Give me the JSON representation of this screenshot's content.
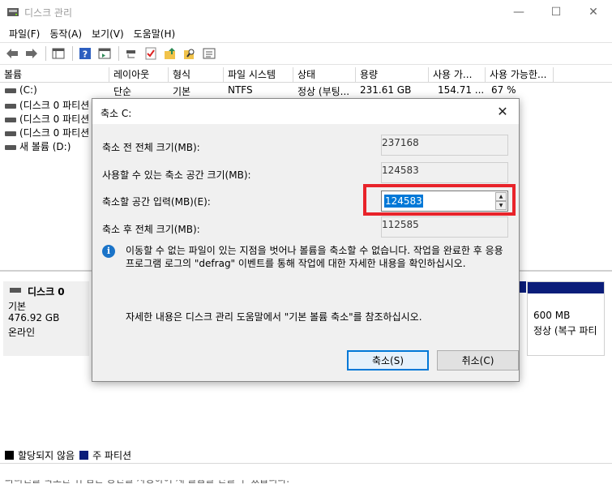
{
  "window": {
    "title": "디스크 관리",
    "minimize": "—",
    "maximize": "☐",
    "close": "✕"
  },
  "menu": [
    "파일(F)",
    "동작(A)",
    "보기(V)",
    "도움말(H)"
  ],
  "volume_table": {
    "headers": [
      "볼륨",
      "레이아웃",
      "형식",
      "파일 시스템",
      "상태",
      "용량",
      "사용 가...",
      "사용 가능한..."
    ],
    "rows": [
      {
        "volume": "(C:)",
        "layout": "단순",
        "type": "기본",
        "fs": "NTFS",
        "status": "정상 (부팅...",
        "capacity": "231.61 GB",
        "free": "154.71 ...",
        "pct": "67 %"
      },
      {
        "volume": "(디스크 0 파티션",
        "layout": "",
        "type": "",
        "fs": "",
        "status": "",
        "capacity": "",
        "free": "",
        "pct": ""
      },
      {
        "volume": "(디스크 0 파티션",
        "layout": "",
        "type": "",
        "fs": "",
        "status": "",
        "capacity": "",
        "free": "",
        "pct": ""
      },
      {
        "volume": "(디스크 0 파티션",
        "layout": "",
        "type": "",
        "fs": "",
        "status": "",
        "capacity": "",
        "free": "",
        "pct": ""
      },
      {
        "volume": "새 볼륨 (D:)",
        "layout": "",
        "type": "",
        "fs": "",
        "status": "",
        "capacity": "",
        "free": "",
        "pct": ""
      }
    ]
  },
  "disk": {
    "name": "디스크 0",
    "type": "기본",
    "size": "476.92 GB",
    "status": "온라인",
    "last_partition": {
      "size": "600 MB",
      "status": "정상 (복구 파티"
    }
  },
  "legend": [
    {
      "label": "할당되지 않음",
      "color": "#000000"
    },
    {
      "label": "주 파티션",
      "color": "#0b1d7a"
    }
  ],
  "bottom_partial_text": "파티션을 축소한 뒤 남은 공간을 사용하여 새 볼륨을 만들 수 있습니다.",
  "dialog": {
    "title": "축소 C:",
    "close": "✕",
    "total_before_label": "축소 전 전체 크기(MB):",
    "total_before_value": "237168",
    "available_label": "사용할 수 있는 축소 공간 크기(MB):",
    "available_value": "124583",
    "input_label": "축소할 공간 입력(MB)(E):",
    "input_value": "124583",
    "total_after_label": "축소 후 전체 크기(MB):",
    "total_after_value": "112585",
    "info_text": "이동할 수 없는 파일이 있는 지점을 벗어나 볼륨을 축소할 수 없습니다. 작업을 완료한 후 응용 프로그램 로그의 \"defrag\" 이벤트를 통해 작업에 대한 자세한 내용을 확인하십시오.",
    "help_text": "자세한 내용은 디스크 관리 도움말에서 \"기본 볼륨 축소\"를 참조하십시오.",
    "ok_label": "축소(S)",
    "cancel_label": "취소(C)"
  },
  "colors": {
    "accent": "#0078d7",
    "highlight": "#e8232a",
    "primary_partition": "#0b1d7a"
  }
}
